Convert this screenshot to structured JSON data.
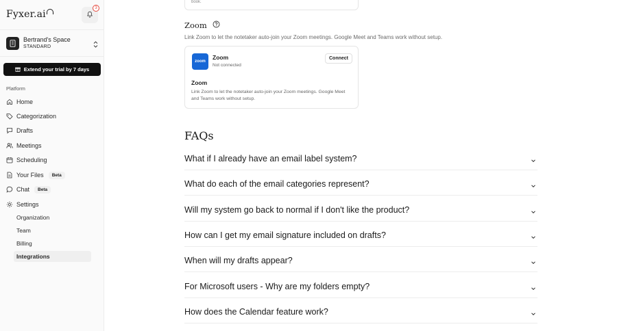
{
  "app": {
    "logo_text": "Fyxer.ai",
    "notification_count": "3"
  },
  "workspace": {
    "name": "Bertrand's Space",
    "plan": "STANDARD"
  },
  "trial_button": "Extend your trial by 7 days",
  "sidebar": {
    "section_label": "Platform",
    "items": [
      {
        "label": "Home",
        "icon": "home-icon"
      },
      {
        "label": "Categorization",
        "icon": "tag-icon"
      },
      {
        "label": "Drafts",
        "icon": "message-icon"
      },
      {
        "label": "Meetings",
        "icon": "people-icon"
      },
      {
        "label": "Scheduling",
        "icon": "calendar-icon"
      },
      {
        "label": "Your Files",
        "icon": "file-icon",
        "badge": "Beta"
      },
      {
        "label": "Chat",
        "icon": "chat-icon",
        "badge": "Beta"
      },
      {
        "label": "Settings",
        "icon": "gear-icon"
      }
    ],
    "settings_subitems": [
      "Organization",
      "Team",
      "Billing",
      "Integrations"
    ],
    "active_subitem": "Integrations"
  },
  "main": {
    "prev_card_text": "book.",
    "zoom_section": {
      "title": "Zoom",
      "description": "Link Zoom to let the notetaker auto-join your Zoom meetings. Google Meet and Teams work without setup.",
      "card": {
        "logo_text": "zoom",
        "name": "Zoom",
        "status": "Not connected",
        "button": "Connect",
        "sub_title": "Zoom",
        "sub_description": "Link Zoom to let the notetaker auto-join your Zoom meetings. Google Meet and Teams work without setup."
      }
    },
    "faqs": {
      "title": "FAQs",
      "items": [
        "What if I already have an email label system?",
        "What do each of the email categories represent?",
        "Will my system go back to normal if I don't like the product?",
        "How can I get my email signature included on drafts?",
        "When will my drafts appear?",
        "For Microsoft users - Why are my folders empty?",
        "How does the Calendar feature work?"
      ]
    }
  },
  "colors": {
    "accent_dark": "#111111",
    "zoom_blue": "#1767d6",
    "badge_red": "#e5483d"
  }
}
